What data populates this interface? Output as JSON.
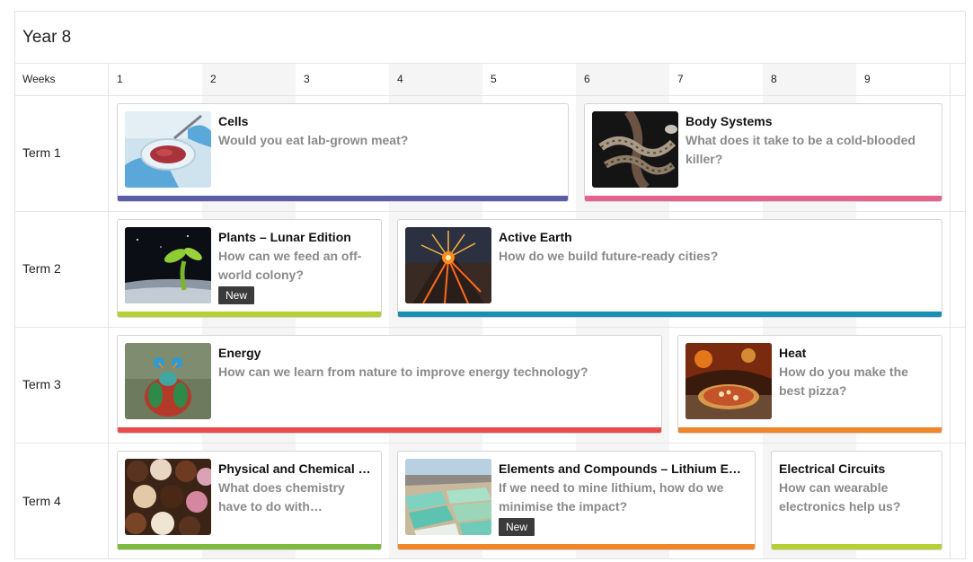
{
  "page": {
    "title": "Year 8"
  },
  "grid": {
    "weeks_label": "Weeks",
    "weeks": [
      "1",
      "2",
      "3",
      "4",
      "5",
      "6",
      "7",
      "8",
      "9"
    ]
  },
  "terms": [
    {
      "label": "Term 1",
      "units": [
        {
          "title": "Cells",
          "question": "Would you eat lab-grown meat?",
          "badge": "",
          "color": "#5b5ea6",
          "icon": "petri-dish-icon"
        },
        {
          "title": "Body Systems",
          "question": "What does it take to be a cold-blooded killer?",
          "badge": "",
          "color": "#e8638b",
          "icon": "snake-icon"
        }
      ]
    },
    {
      "label": "Term 2",
      "units": [
        {
          "title": "Plants – Lunar Edition",
          "question": "How can we feed an off-world colony?",
          "badge": "New",
          "color": "#b5cf34",
          "icon": "seedling-icon"
        },
        {
          "title": "Active Earth",
          "question": "How do we build future-ready cities?",
          "badge": "",
          "color": "#1a8fb5",
          "icon": "volcano-icon"
        }
      ]
    },
    {
      "label": "Term 3",
      "units": [
        {
          "title": "Energy",
          "question": "How can we learn from nature to improve energy technology?",
          "badge": "",
          "color": "#e94b4b",
          "icon": "mantis-shrimp-icon"
        },
        {
          "title": "Heat",
          "question": "How do you make the best pizza?",
          "badge": "",
          "color": "#f0862a",
          "icon": "pizza-icon"
        }
      ]
    },
    {
      "label": "Term 4",
      "units": [
        {
          "title": "Physical and Chemical Changes",
          "question": "What does chemistry have to do with chocolate?",
          "badge": "",
          "color": "#7cbb3f",
          "icon": "chocolates-icon"
        },
        {
          "title": "Elements and Compounds – Lithium Edition",
          "question": "If we need to mine lithium, how do we minimise the impact?",
          "badge": "New",
          "color": "#f0862a",
          "icon": "lithium-ponds-icon"
        },
        {
          "title": "Electrical Circuits",
          "question": "How can wearable electronics help us?",
          "badge": "",
          "color": "#b5cf34",
          "icon": ""
        }
      ]
    }
  ]
}
